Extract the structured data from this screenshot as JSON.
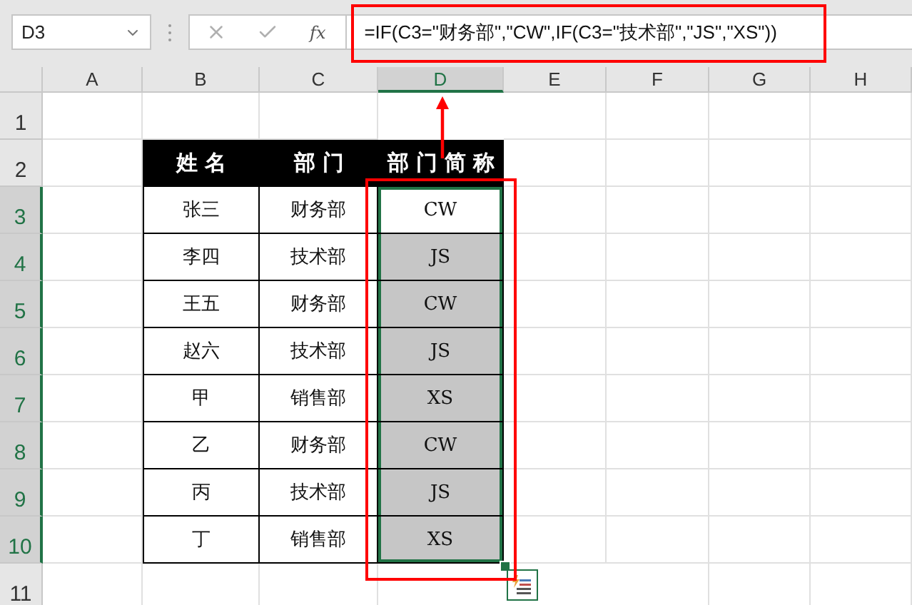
{
  "name_box": "D3",
  "fx_label": "fx",
  "formula": "=IF(C3=\"财务部\",\"CW\",IF(C3=\"技术部\",\"JS\",\"XS\"))",
  "columns": [
    {
      "label": "A",
      "selected": false
    },
    {
      "label": "B",
      "selected": false
    },
    {
      "label": "C",
      "selected": false
    },
    {
      "label": "D",
      "selected": true
    },
    {
      "label": "E",
      "selected": false
    },
    {
      "label": "F",
      "selected": false
    },
    {
      "label": "G",
      "selected": false
    },
    {
      "label": "H",
      "selected": false
    }
  ],
  "row_labels": [
    {
      "label": "1",
      "selected": false
    },
    {
      "label": "2",
      "selected": false
    },
    {
      "label": "3",
      "selected": true
    },
    {
      "label": "4",
      "selected": true
    },
    {
      "label": "5",
      "selected": true
    },
    {
      "label": "6",
      "selected": true
    },
    {
      "label": "7",
      "selected": true
    },
    {
      "label": "8",
      "selected": true
    },
    {
      "label": "9",
      "selected": true
    },
    {
      "label": "10",
      "selected": true
    },
    {
      "label": "11",
      "selected": false
    }
  ],
  "table": {
    "header": [
      "姓名",
      "部门",
      "部门简称"
    ],
    "rows": [
      {
        "name": "张三",
        "dept": "财务部",
        "abbr": "CW",
        "selected": true,
        "active": true
      },
      {
        "name": "李四",
        "dept": "技术部",
        "abbr": "JS",
        "selected": true,
        "active": false
      },
      {
        "name": "王五",
        "dept": "财务部",
        "abbr": "CW",
        "selected": true,
        "active": false
      },
      {
        "name": "赵六",
        "dept": "技术部",
        "abbr": "JS",
        "selected": true,
        "active": false
      },
      {
        "name": "甲",
        "dept": "销售部",
        "abbr": "XS",
        "selected": true,
        "active": false
      },
      {
        "name": "乙",
        "dept": "财务部",
        "abbr": "CW",
        "selected": true,
        "active": false
      },
      {
        "name": "丙",
        "dept": "技术部",
        "abbr": "JS",
        "selected": true,
        "active": false
      },
      {
        "name": "丁",
        "dept": "销售部",
        "abbr": "XS",
        "selected": true,
        "active": false
      }
    ]
  }
}
